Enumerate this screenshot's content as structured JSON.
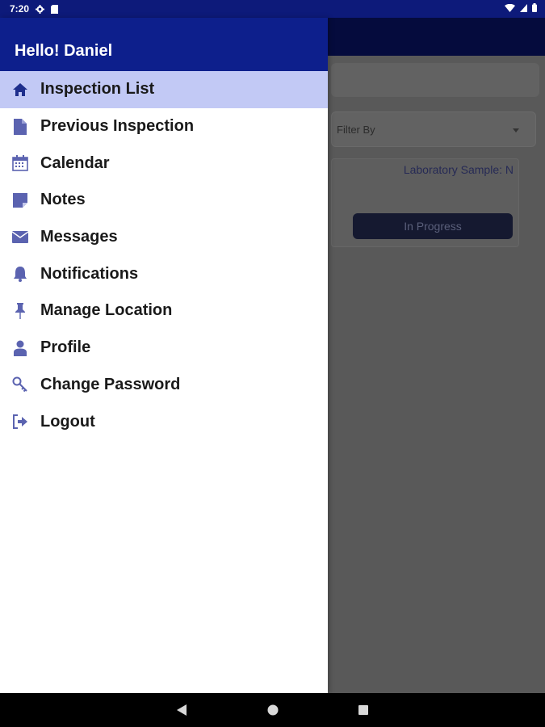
{
  "status_bar": {
    "time": "7:20"
  },
  "drawer": {
    "greeting": "Hello! Daniel",
    "items": [
      {
        "label": "Inspection List",
        "icon": "home-icon",
        "active": true
      },
      {
        "label": "Previous Inspection",
        "icon": "file-icon",
        "active": false
      },
      {
        "label": "Calendar",
        "icon": "calendar-icon",
        "active": false
      },
      {
        "label": "Notes",
        "icon": "note-icon",
        "active": false
      },
      {
        "label": "Messages",
        "icon": "envelope-icon",
        "active": false
      },
      {
        "label": "Notifications",
        "icon": "bell-icon",
        "active": false
      },
      {
        "label": "Manage Location",
        "icon": "pin-icon",
        "active": false
      },
      {
        "label": "Profile",
        "icon": "user-icon",
        "active": false
      },
      {
        "label": "Change Password",
        "icon": "key-icon",
        "active": false
      },
      {
        "label": "Logout",
        "icon": "logout-icon",
        "active": false
      }
    ]
  },
  "background": {
    "filter_placeholder": "Filter By",
    "card": {
      "laboratory_sample": "Laboratory Sample: N",
      "status_button": "In Progress"
    }
  },
  "colors": {
    "header": "#0d1f8c",
    "status_bar": "#0d1a7a",
    "active_item": "#c2c9f5",
    "icon": "#5b63b0"
  }
}
